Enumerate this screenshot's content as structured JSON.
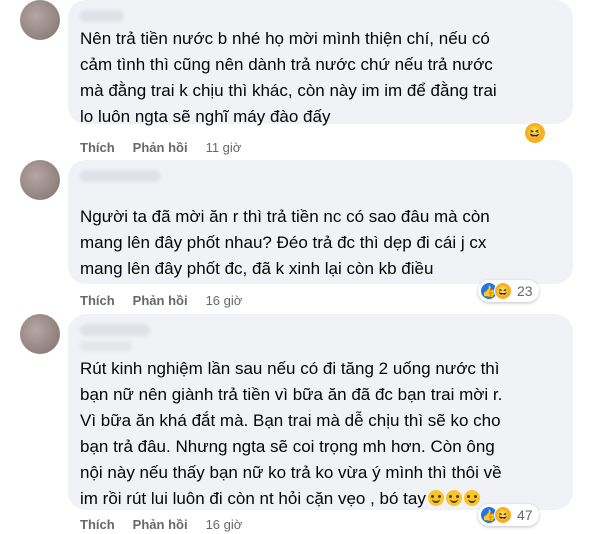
{
  "comments": [
    {
      "text": "Nên trả tiền nước b nhé họ mời mình thiện chí, nếu có\ncảm tình thì cũng nên dành trả nước chứ nếu trả nước\nmà đằng trai k chịu thì khác, còn này im im để đằng trai\nlo luôn ngta sẽ nghĩ máy đào đấy",
      "like": "Thích",
      "reply": "Phản hồi",
      "time": "11 giờ",
      "reaction_icon": "haha-icon"
    },
    {
      "text": "Người ta đã mời ăn r thì trả tiền nc có sao đâu mà còn\nmang lên đây phốt nhau? Đéo trả đc thì dẹp đi cái j cx\nmang lên đây phốt đc, đã k xinh lại còn kb điều",
      "like": "Thích",
      "reply": "Phản hồi",
      "time": "16 giờ",
      "reaction_count": "23",
      "reaction_icons": [
        "like-icon",
        "haha-icon"
      ]
    },
    {
      "text": "Rút kinh nghiệm lần sau nếu có đi tăng 2 uống nước thì\nbạn nữ nên giành trả tiền vì bữa ăn đã đc bạn trai mời r.\nVì bữa ăn khá đắt mà. Bạn trai mà dễ chịu thì sẽ ko cho\nbạn trả đâu. Nhưng ngta sẽ coi trọng mh hơn. Còn ông\nnội này nếu thấy bạn nữ ko trả ko vừa ý mình thì thôi về\nim rồi rút lui luôn đi còn nt hỏi cặn vẹo , bó tay",
      "like": "Thích",
      "reply": "Phản hồi",
      "time": "16 giờ",
      "reaction_count": "47",
      "reaction_icons": [
        "like-icon",
        "haha-icon"
      ],
      "trailing_emoji": "rolling-eyes-emoji x3"
    }
  ]
}
